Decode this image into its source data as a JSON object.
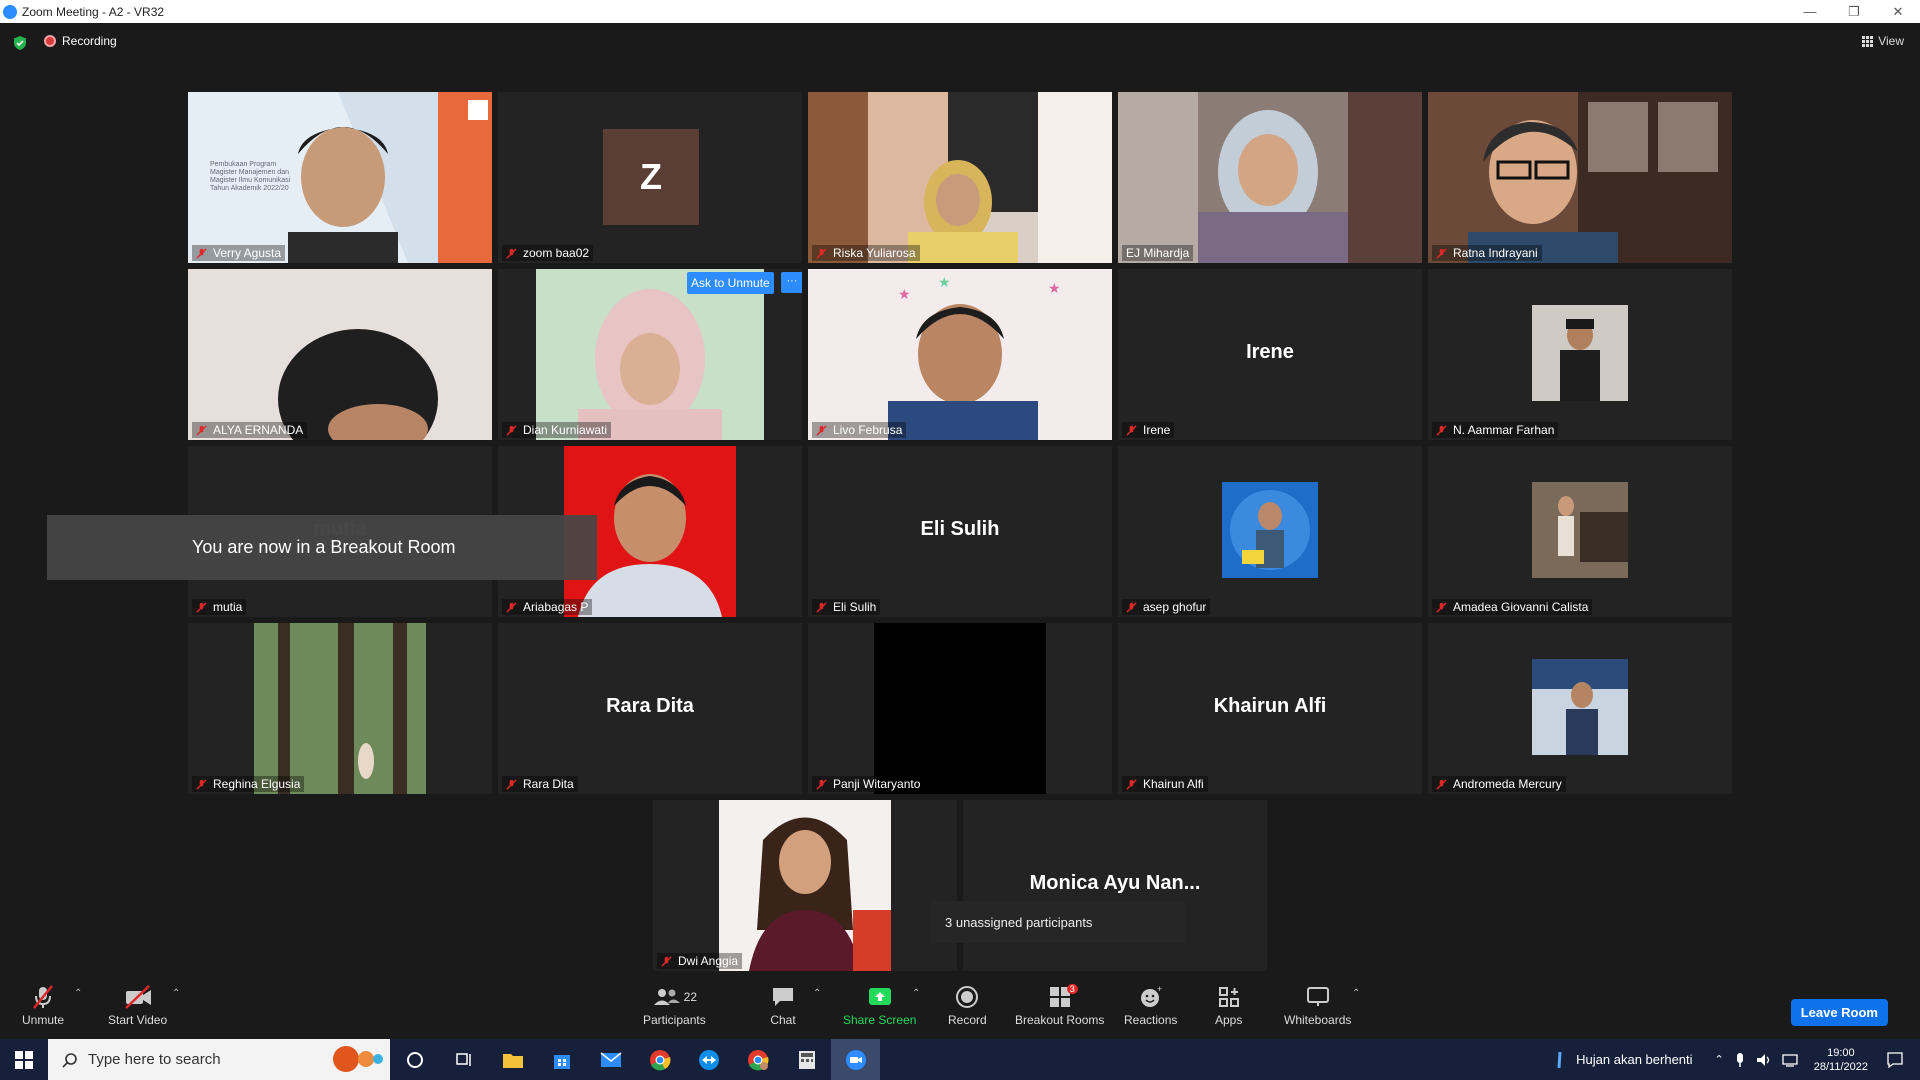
{
  "window": {
    "title": "Zoom Meeting - A2 - VR32",
    "minimize_icon": "minimize-icon",
    "restore_icon": "restore-icon",
    "close_icon": "close-icon"
  },
  "topbar": {
    "recording_label": "Recording",
    "view_label": "View"
  },
  "tiles": [
    {
      "name": "Verry Agusta"
    },
    {
      "name": "zoom baa02",
      "avatar_letter": "Z"
    },
    {
      "name": "Riska Yuliarosa"
    },
    {
      "name": "EJ Mihardja"
    },
    {
      "name": "Ratna Indrayani"
    },
    {
      "name": "ALYA ERNANDA"
    },
    {
      "name": "Dian Kurniawati",
      "ask_unmute": "Ask to Unmute",
      "more": "···"
    },
    {
      "name": "Livo Februsa"
    },
    {
      "name": "Irene",
      "display": "Irene"
    },
    {
      "name": "N. Aammar Farhan"
    },
    {
      "name": "mutia",
      "display": "mutia"
    },
    {
      "name": "Ariabagas P"
    },
    {
      "name": "Eli Sulih",
      "display": "Eli Sulih"
    },
    {
      "name": "asep ghofur"
    },
    {
      "name": "Amadea Giovanni Calista"
    },
    {
      "name": "Reghina Elgusia"
    },
    {
      "name": "Rara Dita",
      "display": "Rara Dita"
    },
    {
      "name": "Panji Witaryanto"
    },
    {
      "name": "Khairun Alfi",
      "display": "Khairun Alfi"
    },
    {
      "name": "Andromeda Mercury"
    },
    {
      "name": "Dwi Anggia"
    },
    {
      "name": "",
      "display": "Monica Ayu Nan..."
    }
  ],
  "slide_text": {
    "lines": [
      "Pembukaan Program",
      "Magister Manajemen dan",
      "Magister Ilmu Komunikasi",
      "Tahun Akademik 2022/20"
    ]
  },
  "toast": "You are now in a Breakout Room",
  "unassigned": "3 unassigned participants",
  "toolbar": {
    "unmute": "Unmute",
    "start_video": "Start Video",
    "participants": "Participants",
    "participants_count": "22",
    "chat": "Chat",
    "share_screen": "Share Screen",
    "record": "Record",
    "breakout_rooms": "Breakout Rooms",
    "breakout_badge": "3",
    "reactions": "Reactions",
    "apps": "Apps",
    "whiteboards": "Whiteboards",
    "leave_room": "Leave Room"
  },
  "taskbar": {
    "search_placeholder": "Type here to search",
    "weather": "Hujan akan berhenti",
    "time": "19:00",
    "date": "28/11/2022"
  },
  "colors": {
    "zoom_blue": "#2d8cff",
    "active_speaker": "#c8e25a",
    "share_green": "#23d959",
    "mute_red": "#e02828"
  }
}
